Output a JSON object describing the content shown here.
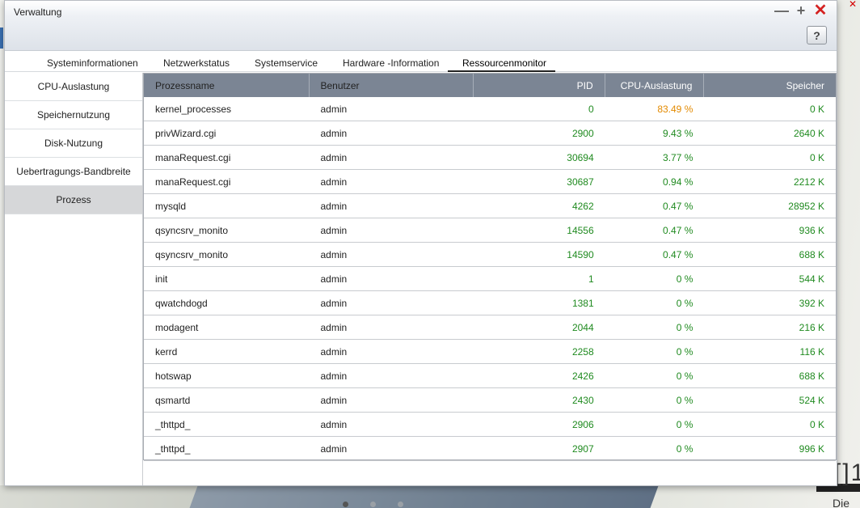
{
  "window": {
    "title": "Verwaltung",
    "help_label": "?"
  },
  "tabs": [
    {
      "label": "Systeminformationen"
    },
    {
      "label": "Netzwerkstatus"
    },
    {
      "label": "Systemservice"
    },
    {
      "label": "Hardware -Information"
    },
    {
      "label": "Ressourcenmonitor",
      "active": true
    }
  ],
  "sidebar": {
    "items": [
      {
        "label": "CPU-Auslastung"
      },
      {
        "label": "Speichernutzung"
      },
      {
        "label": "Disk-Nutzung"
      },
      {
        "label": "Uebertragungs-Bandbreite"
      },
      {
        "label": "Prozess",
        "active": true
      }
    ]
  },
  "table": {
    "columns": [
      "Prozessname",
      "Benutzer",
      "PID",
      "CPU-Auslastung",
      "Speicher"
    ],
    "rows": [
      [
        "kernel_processes",
        "admin",
        "0",
        "83.49 %",
        "0 K"
      ],
      [
        "privWizard.cgi",
        "admin",
        "2900",
        "9.43 %",
        "2640 K"
      ],
      [
        "manaRequest.cgi",
        "admin",
        "30694",
        "3.77 %",
        "0 K"
      ],
      [
        "manaRequest.cgi",
        "admin",
        "30687",
        "0.94 %",
        "2212 K"
      ],
      [
        "mysqld",
        "admin",
        "4262",
        "0.47 %",
        "28952 K"
      ],
      [
        "qsyncsrv_monito",
        "admin",
        "14556",
        "0.47 %",
        "936 K"
      ],
      [
        "qsyncsrv_monito",
        "admin",
        "14590",
        "0.47 %",
        "688 K"
      ],
      [
        "init",
        "admin",
        "1",
        "0 %",
        "544 K"
      ],
      [
        "qwatchdogd",
        "admin",
        "1381",
        "0 %",
        "392 K"
      ],
      [
        "modagent",
        "admin",
        "2044",
        "0 %",
        "216 K"
      ],
      [
        "kerrd",
        "admin",
        "2258",
        "0 %",
        "116 K"
      ],
      [
        "hotswap",
        "admin",
        "2426",
        "0 %",
        "688 K"
      ],
      [
        "qsmartd",
        "admin",
        "2430",
        "0 %",
        "524 K"
      ],
      [
        "_thttpd_",
        "admin",
        "2906",
        "0 %",
        "0 K"
      ],
      [
        "_thttpd_",
        "admin",
        "2907",
        "0 %",
        "996 K"
      ]
    ]
  },
  "desktop": {
    "big_text": "[]1",
    "text": "Die"
  },
  "colors": {
    "header_bg": "#7b8594",
    "value_green": "#1f8a1f",
    "value_orange": "#e38a00",
    "close_red": "#d42020"
  }
}
